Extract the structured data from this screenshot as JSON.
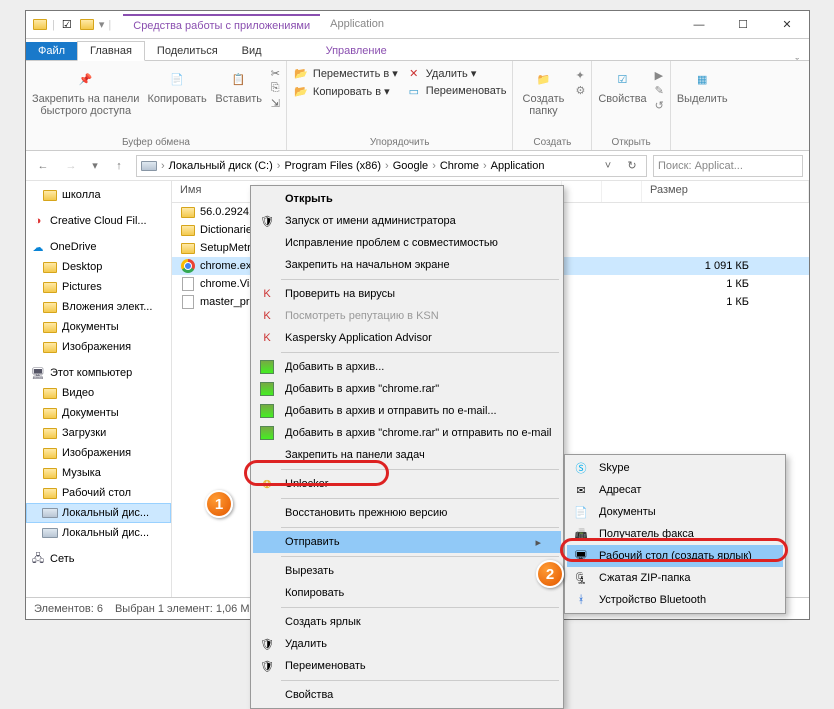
{
  "titlebar": {
    "contextualTab": "Средства работы с приложениями",
    "title": "Application"
  },
  "ribbonTabs": {
    "file": "Файл",
    "home": "Главная",
    "share": "Поделиться",
    "view": "Вид",
    "manage": "Управление"
  },
  "ribbon": {
    "pin": "Закрепить на панели\nбыстрого доступа",
    "copy": "Копировать",
    "paste": "Вставить",
    "clipboardGroup": "Буфер обмена",
    "moveTo": "Переместить в ▾",
    "copyTo": "Копировать в ▾",
    "del": "Удалить ▾",
    "rename": "Переименовать",
    "organizeGroup": "Упорядочить",
    "newFolder": "Создать\nпапку",
    "newGroup": "Создать",
    "properties": "Свойства",
    "openGroup": "Открыть",
    "select": "Выделить",
    "selectGroup": ""
  },
  "address": {
    "crumbs": [
      "Локальный диск (C:)",
      "Program Files (x86)",
      "Google",
      "Chrome",
      "Application"
    ],
    "searchPlaceholder": "Поиск: Applicat..."
  },
  "tree": [
    {
      "label": "школла",
      "kind": "folder",
      "lvl": 1
    },
    {
      "spacer": true
    },
    {
      "label": "Creative Cloud Fil...",
      "kind": "cc",
      "lvl": 0
    },
    {
      "spacer": true
    },
    {
      "label": "OneDrive",
      "kind": "onedrive",
      "lvl": 0
    },
    {
      "label": "Desktop",
      "kind": "folder",
      "lvl": 1
    },
    {
      "label": "Pictures",
      "kind": "folder",
      "lvl": 1
    },
    {
      "label": "Вложения элект...",
      "kind": "folder",
      "lvl": 1
    },
    {
      "label": "Документы",
      "kind": "folder",
      "lvl": 1
    },
    {
      "label": "Изображения",
      "kind": "folder",
      "lvl": 1
    },
    {
      "spacer": true
    },
    {
      "label": "Этот компьютер",
      "kind": "pc",
      "lvl": 0
    },
    {
      "label": "Видео",
      "kind": "folder",
      "lvl": 1
    },
    {
      "label": "Документы",
      "kind": "folder",
      "lvl": 1
    },
    {
      "label": "Загрузки",
      "kind": "folder",
      "lvl": 1
    },
    {
      "label": "Изображения",
      "kind": "folder",
      "lvl": 1
    },
    {
      "label": "Музыка",
      "kind": "folder",
      "lvl": 1
    },
    {
      "label": "Рабочий стол",
      "kind": "folder",
      "lvl": 1
    },
    {
      "label": "Локальный дис...",
      "kind": "drive",
      "lvl": 1,
      "sel": true
    },
    {
      "label": "Локальный дис...",
      "kind": "drive",
      "lvl": 1
    },
    {
      "spacer": true
    },
    {
      "label": "Сеть",
      "kind": "net",
      "lvl": 0
    }
  ],
  "columns": {
    "name": "Имя",
    "date": "",
    "type": "",
    "size": "Размер"
  },
  "files": [
    {
      "name": "56.0.2924.87",
      "kind": "folder",
      "size": ""
    },
    {
      "name": "Dictionaries",
      "kind": "folder",
      "size": ""
    },
    {
      "name": "SetupMetric...",
      "kind": "folder",
      "size": ""
    },
    {
      "name": "chrome.exe",
      "kind": "chrome",
      "size": "1 091 КБ",
      "sel": true
    },
    {
      "name": "chrome.Visu...",
      "kind": "file",
      "size": "1 КБ"
    },
    {
      "name": "master_pref...",
      "kind": "file",
      "size": "1 КБ"
    }
  ],
  "status": {
    "count": "Элементов: 6",
    "sel": "Выбран 1 элемент: 1,06 МБ"
  },
  "ctx1": [
    {
      "label": "Открыть",
      "bold": true
    },
    {
      "label": "Запуск от имени администратора",
      "icon": "shield"
    },
    {
      "label": "Исправление проблем с совместимостью"
    },
    {
      "label": "Закрепить на начальном экране"
    },
    {
      "sep": true
    },
    {
      "label": "Проверить на вирусы",
      "icon": "kav"
    },
    {
      "label": "Посмотреть репутацию в KSN",
      "icon": "kav",
      "dis": true
    },
    {
      "label": "Kaspersky Application Advisor",
      "icon": "kav"
    },
    {
      "sep": true
    },
    {
      "label": "Добавить в архив...",
      "icon": "rar"
    },
    {
      "label": "Добавить в архив \"chrome.rar\"",
      "icon": "rar"
    },
    {
      "label": "Добавить в архив и отправить по e-mail...",
      "icon": "rar"
    },
    {
      "label": "Добавить в архив \"chrome.rar\" и отправить по e-mail",
      "icon": "rar"
    },
    {
      "label": "Закрепить на панели задач"
    },
    {
      "sep": true
    },
    {
      "label": "Unlocker",
      "icon": "unlocker"
    },
    {
      "sep": true
    },
    {
      "label": "Восстановить прежнюю версию"
    },
    {
      "sep": true
    },
    {
      "label": "Отправить",
      "arrow": true,
      "hover": true
    },
    {
      "sep": true
    },
    {
      "label": "Вырезать"
    },
    {
      "label": "Копировать"
    },
    {
      "sep": true
    },
    {
      "label": "Создать ярлык"
    },
    {
      "label": "Удалить",
      "icon": "shield"
    },
    {
      "label": "Переименовать",
      "icon": "shield"
    },
    {
      "sep": true
    },
    {
      "label": "Свойства"
    }
  ],
  "ctx2": [
    {
      "label": "Skype",
      "icon": "skype"
    },
    {
      "label": "Адресат",
      "icon": "mail"
    },
    {
      "label": "Документы",
      "icon": "docs"
    },
    {
      "label": "Получатель факса",
      "icon": "fax"
    },
    {
      "label": "Рабочий стол (создать ярлык)",
      "icon": "desktop",
      "hover": true
    },
    {
      "label": "Сжатая ZIP-папка",
      "icon": "zip"
    },
    {
      "label": "Устройство Bluetooth",
      "icon": "bt"
    }
  ]
}
